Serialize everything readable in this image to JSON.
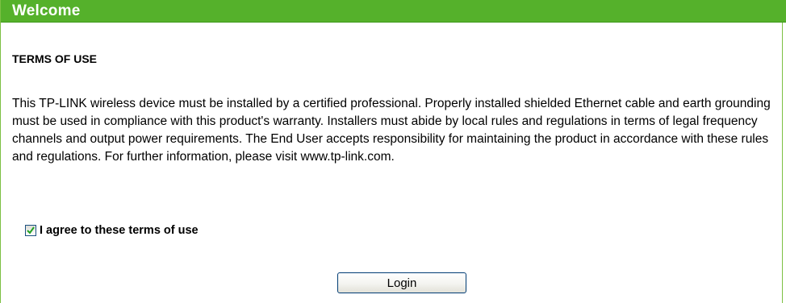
{
  "header": {
    "title": "Welcome"
  },
  "terms": {
    "heading": "TERMS OF USE",
    "body": "This TP-LINK wireless device must be installed by a certified professional. Properly installed shielded Ethernet cable and earth grounding must be used in compliance with this product's warranty. Installers must abide by local rules and regulations in terms of legal frequency channels and output power requirements. The End User accepts responsibility for maintaining the product in accordance with these rules and regulations. For further information, please visit www.tp-link.com."
  },
  "agreement": {
    "checked": true,
    "label": "I agree to these terms of use"
  },
  "actions": {
    "login_label": "Login"
  },
  "colors": {
    "title_bar": "#55b12b",
    "border": "#7cc043",
    "check_mark": "#21a121"
  }
}
